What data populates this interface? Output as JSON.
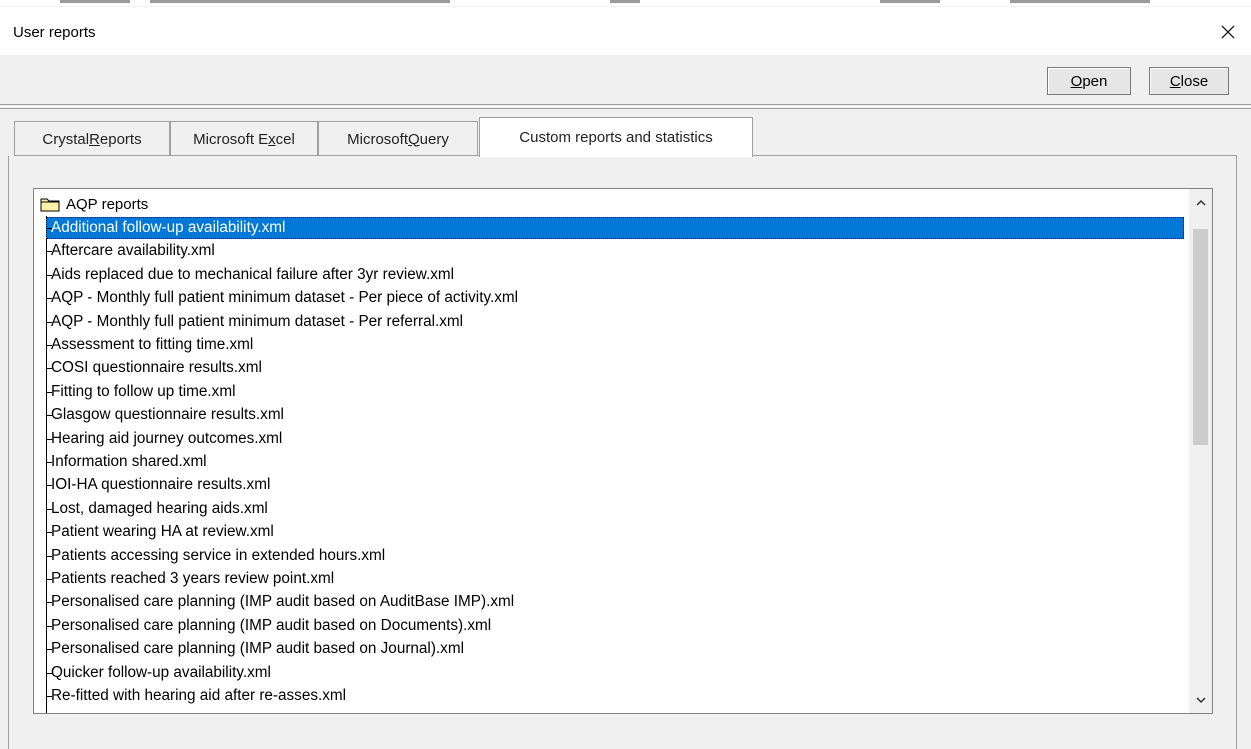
{
  "window": {
    "title": "User reports"
  },
  "toolbar": {
    "open": {
      "mnemonic": "O",
      "rest": "pen"
    },
    "close": {
      "mnemonic": "C",
      "rest": "lose"
    }
  },
  "tabs": [
    {
      "pre": "Crystal ",
      "mnemonic": "R",
      "post": "eports",
      "active": false
    },
    {
      "pre": "Microsoft E",
      "mnemonic": "x",
      "post": "cel",
      "active": false
    },
    {
      "pre": "Microsoft ",
      "mnemonic": "Q",
      "post": "uery",
      "active": false
    },
    {
      "pre": "Custom reports and statistics",
      "mnemonic": "",
      "post": "",
      "active": true
    }
  ],
  "tree": {
    "root_label": "AQP reports",
    "selected_index": 0,
    "items": [
      "Additional follow-up availability.xml",
      "Aftercare availability.xml",
      "Aids replaced due to mechanical failure after 3yr review.xml",
      "AQP - Monthly full patient minimum dataset - Per piece of activity.xml",
      "AQP - Monthly full patient minimum dataset - Per referral.xml",
      "Assessment to fitting time.xml",
      "COSI questionnaire results.xml",
      "Fitting to follow up time.xml",
      "Glasgow questionnaire results.xml",
      "Hearing aid journey outcomes.xml",
      "Information shared.xml",
      "IOI-HA questionnaire results.xml",
      "Lost, damaged hearing aids.xml",
      "Patient wearing HA at review.xml",
      "Patients accessing service in extended hours.xml",
      "Patients reached 3 years review point.xml",
      "Personalised care planning (IMP audit based on AuditBase IMP).xml",
      "Personalised care planning (IMP audit based on Documents).xml",
      "Personalised care planning (IMP audit based on Journal).xml",
      "Quicker follow-up availability.xml",
      "Re-fitted with hearing aid after re-asses.xml"
    ]
  },
  "colors": {
    "selection": "#0078d7",
    "window_bg": "#f0f0f0"
  }
}
